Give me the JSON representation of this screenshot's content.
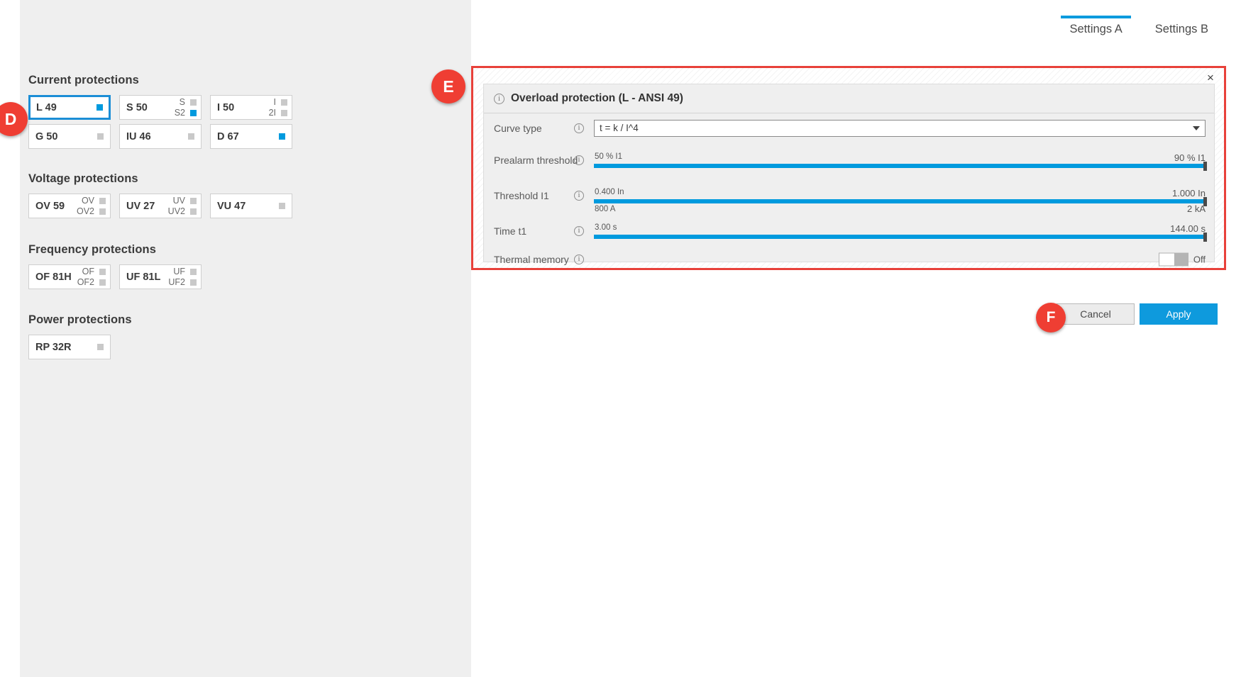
{
  "tabs": [
    {
      "label": "Settings A",
      "active": true
    },
    {
      "label": "Settings B",
      "active": false
    }
  ],
  "left_panel": {
    "sections": [
      {
        "title": "Current protections",
        "cards": [
          {
            "code": "L  49",
            "selected": true,
            "indicator": "on",
            "subs": []
          },
          {
            "code": "S  50",
            "selected": false,
            "indicator": null,
            "subs": [
              {
                "label": "S",
                "state": "off"
              },
              {
                "label": "S2",
                "state": "on"
              }
            ]
          },
          {
            "code": "I  50",
            "selected": false,
            "indicator": null,
            "subs": [
              {
                "label": "I",
                "state": "off"
              },
              {
                "label": "2I",
                "state": "off"
              }
            ]
          },
          {
            "code": "G  50",
            "selected": false,
            "indicator": "off",
            "subs": []
          },
          {
            "code": "IU  46",
            "selected": false,
            "indicator": "off",
            "subs": []
          },
          {
            "code": "D  67",
            "selected": false,
            "indicator": "on",
            "subs": []
          }
        ]
      },
      {
        "title": "Voltage protections",
        "cards": [
          {
            "code": "OV  59",
            "selected": false,
            "indicator": null,
            "subs": [
              {
                "label": "OV",
                "state": "off"
              },
              {
                "label": "OV2",
                "state": "off"
              }
            ]
          },
          {
            "code": "UV  27",
            "selected": false,
            "indicator": null,
            "subs": [
              {
                "label": "UV",
                "state": "off"
              },
              {
                "label": "UV2",
                "state": "off"
              }
            ]
          },
          {
            "code": "VU  47",
            "selected": false,
            "indicator": "off",
            "subs": []
          }
        ]
      },
      {
        "title": "Frequency protections",
        "cards": [
          {
            "code": "OF  81H",
            "selected": false,
            "indicator": null,
            "subs": [
              {
                "label": "OF",
                "state": "off"
              },
              {
                "label": "OF2",
                "state": "off"
              }
            ]
          },
          {
            "code": "UF  81L",
            "selected": false,
            "indicator": null,
            "subs": [
              {
                "label": "UF",
                "state": "off"
              },
              {
                "label": "UF2",
                "state": "off"
              }
            ]
          }
        ]
      },
      {
        "title": "Power protections",
        "cards": [
          {
            "code": "RP  32R",
            "selected": false,
            "indicator": "off",
            "subs": []
          }
        ]
      }
    ]
  },
  "dialog": {
    "title": "Overload protection (L - ANSI 49)",
    "close_icon": "×",
    "info_icon": "i",
    "rows": {
      "curve_type": {
        "label": "Curve type",
        "value": "t = k / I^4"
      },
      "prealarm": {
        "label": "Prealarm threshold",
        "min_label": "50 % I1",
        "max_label": "90 % I1",
        "fill_percent": 100
      },
      "threshold": {
        "label": "Threshold I1",
        "min_label": "0.400 In",
        "min_sub_label": "800 A",
        "max_label": "1.000 In",
        "max_sub_label": "2 kA",
        "fill_percent": 100
      },
      "time": {
        "label": "Time t1",
        "min_label": "3.00 s",
        "max_label": "144.00 s",
        "fill_percent": 100
      },
      "thermal_memory": {
        "label": "Thermal memory",
        "state_label": "Off",
        "on": false
      }
    }
  },
  "actions": {
    "cancel_label": "Cancel",
    "apply_label": "Apply"
  },
  "callouts": {
    "d": "D",
    "e": "E",
    "f": "F"
  },
  "colors": {
    "accent": "#009ade",
    "apply": "#0e9add",
    "highlight_frame": "#e8413a",
    "badge": "#ef3e33",
    "panel_bg": "#efefef"
  }
}
